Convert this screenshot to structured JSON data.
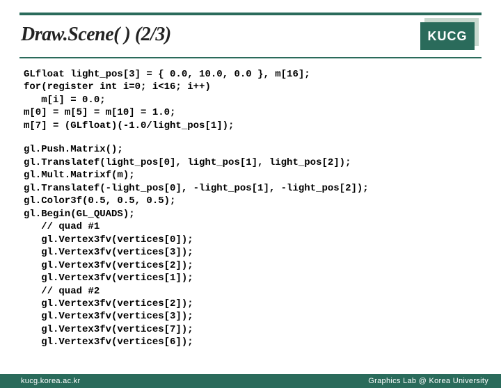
{
  "header": {
    "title": "Draw.Scene( ) (2/3)",
    "badge": "KUCG"
  },
  "code": {
    "block1": "GLfloat light_pos[3] = { 0.0, 10.0, 0.0 }, m[16];\nfor(register int i=0; i<16; i++)\n   m[i] = 0.0;\nm[0] = m[5] = m[10] = 1.0;\nm[7] = (GLfloat)(-1.0/light_pos[1]);",
    "block2": "gl.Push.Matrix();\ngl.Translatef(light_pos[0], light_pos[1], light_pos[2]);\ngl.Mult.Matrixf(m);\ngl.Translatef(-light_pos[0], -light_pos[1], -light_pos[2]);\ngl.Color3f(0.5, 0.5, 0.5);\ngl.Begin(GL_QUADS);\n   // quad #1\n   gl.Vertex3fv(vertices[0]);\n   gl.Vertex3fv(vertices[3]);\n   gl.Vertex3fv(vertices[2]);\n   gl.Vertex3fv(vertices[1]);\n   // quad #2\n   gl.Vertex3fv(vertices[2]);\n   gl.Vertex3fv(vertices[3]);\n   gl.Vertex3fv(vertices[7]);\n   gl.Vertex3fv(vertices[6]);"
  },
  "footer": {
    "left": "kucg.korea.ac.kr",
    "right": "Graphics Lab @ Korea University"
  }
}
